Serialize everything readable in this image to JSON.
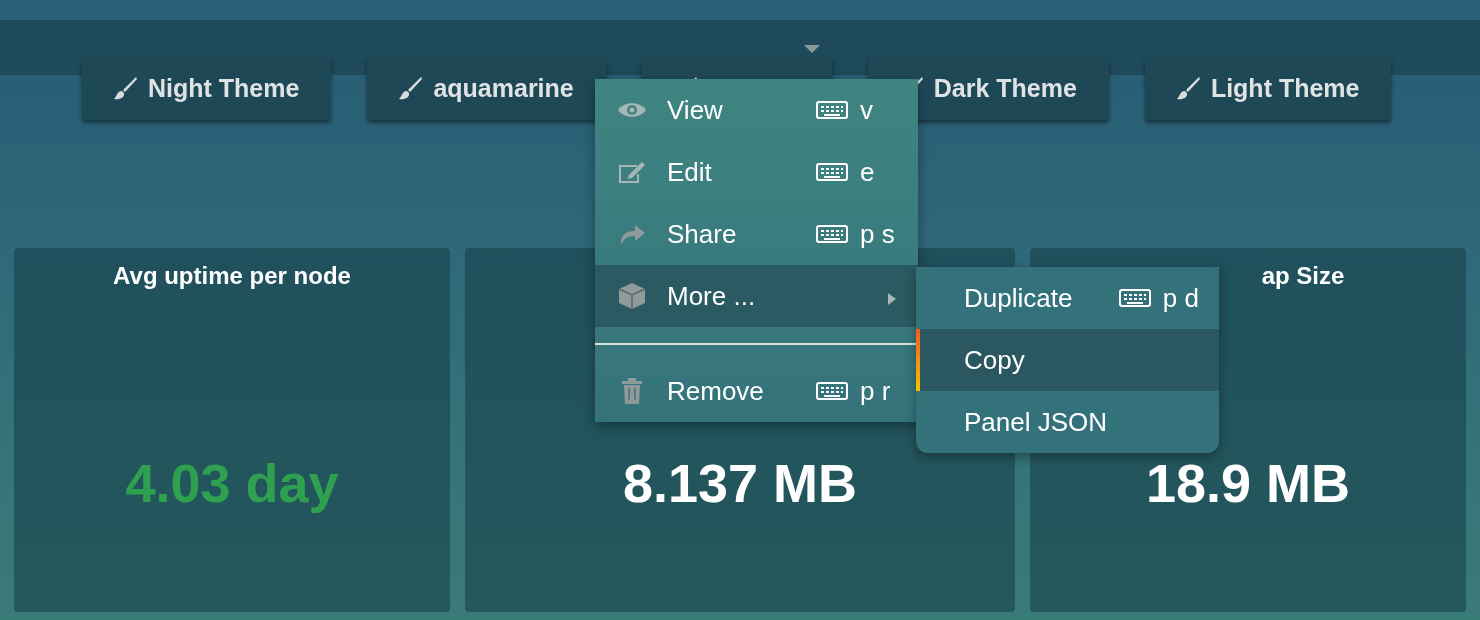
{
  "theme_buttons": [
    {
      "kind": "labeled",
      "label": "Night Theme"
    },
    {
      "kind": "labeled",
      "label": "aquamarine"
    },
    {
      "kind": "covered"
    },
    {
      "kind": "labeled",
      "label": "Dark Theme"
    },
    {
      "kind": "labeled",
      "label": "Light Theme"
    }
  ],
  "panels": [
    {
      "title": "Avg uptime per node",
      "value": "4.03 day",
      "color": "#2ea04f"
    },
    {
      "value": "8.137 MB",
      "color": "#ffffff"
    },
    {
      "title": "ap Size",
      "value": "18.9 MB",
      "color": "#ffffff"
    }
  ],
  "context_menu": {
    "items": [
      {
        "kind": "item",
        "label": "View",
        "shortcut": "v",
        "selected": false
      },
      {
        "kind": "item",
        "label": "Edit",
        "shortcut": "e",
        "selected": false
      },
      {
        "kind": "item",
        "label": "Share",
        "shortcut": "p s",
        "selected": false
      },
      {
        "kind": "submenu",
        "label": "More ...",
        "selected": true
      },
      {
        "kind": "divider"
      },
      {
        "kind": "item",
        "label": "Remove",
        "shortcut": "p r",
        "selected": false
      }
    ],
    "submenu": [
      {
        "label": "Duplicate",
        "shortcut": "p d",
        "selected": false
      },
      {
        "label": "Copy",
        "selected": true
      },
      {
        "label": "Panel JSON",
        "selected": false
      }
    ]
  }
}
